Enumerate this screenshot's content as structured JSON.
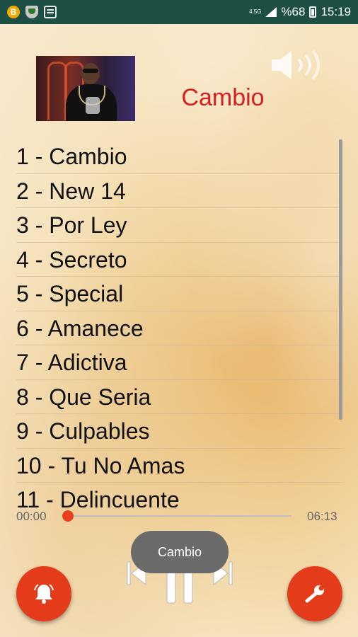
{
  "status_bar": {
    "network_type": "4.5G",
    "battery_percent": "%68",
    "time": "15:19",
    "left_icons": [
      "bitcoin-icon",
      "shield-app-icon",
      "message-icon"
    ]
  },
  "header": {
    "current_song": "Cambio",
    "album_art": "artist-photo",
    "volume_icon": "volume-icon"
  },
  "playlist": {
    "items": [
      "1 - Cambio",
      "2 - New 14",
      "3 - Por Ley",
      "4 - Secreto",
      "5 - Special",
      "6 - Amanece",
      "7 - Adictiva",
      "8 - Que Seria",
      "9 - Culpables",
      "10 - Tu No Amas",
      "11 - Delincuente"
    ]
  },
  "player": {
    "current_time": "00:00",
    "total_time": "06:13",
    "progress": 0,
    "toast_text": "Cambio"
  },
  "colors": {
    "accent": "#e43b1a",
    "title": "#d42020",
    "status_bar": "#1d4f44"
  },
  "icons": {
    "prev": "skip-previous-icon",
    "pause": "pause-icon",
    "next": "skip-next-icon",
    "alarm": "bell-icon",
    "settings": "wrench-icon"
  }
}
